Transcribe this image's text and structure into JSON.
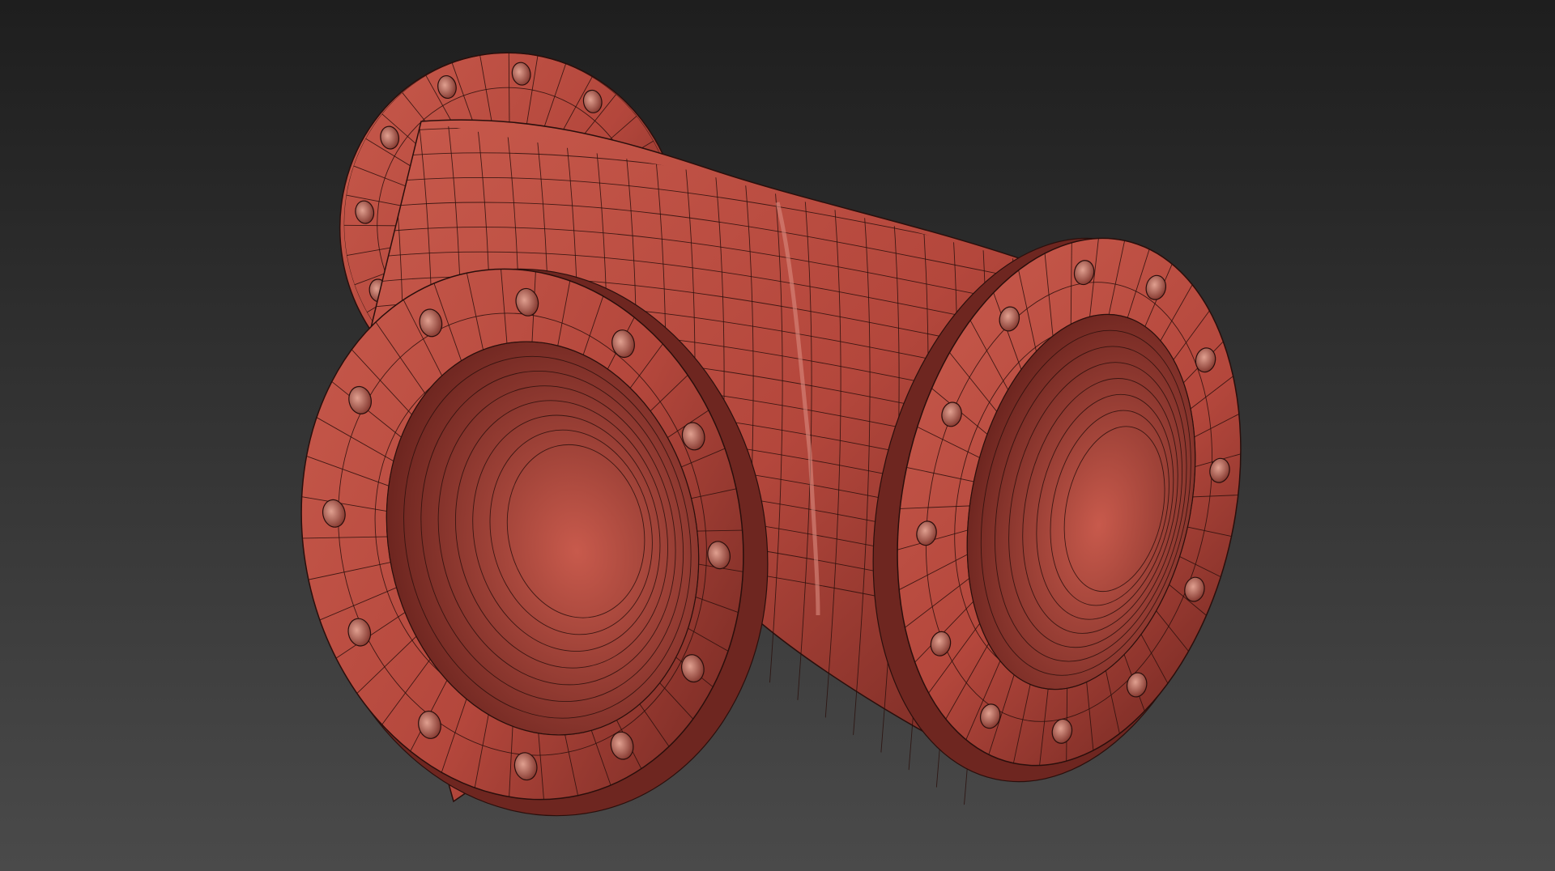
{
  "viewport": {
    "background_top": "#1e1e1e",
    "background_bottom": "#4a4a4a"
  },
  "model": {
    "subject": "flanged-pipe-tee",
    "display_mode": "shaded-with-wireframe-edges",
    "body_color": "#b4473c",
    "body_light": "#c85a4c",
    "body_dark": "#6e2620",
    "wire_color": "#2a0f0c",
    "highlight_color": "#d98a7e",
    "flange_bolt_holes": 12
  }
}
